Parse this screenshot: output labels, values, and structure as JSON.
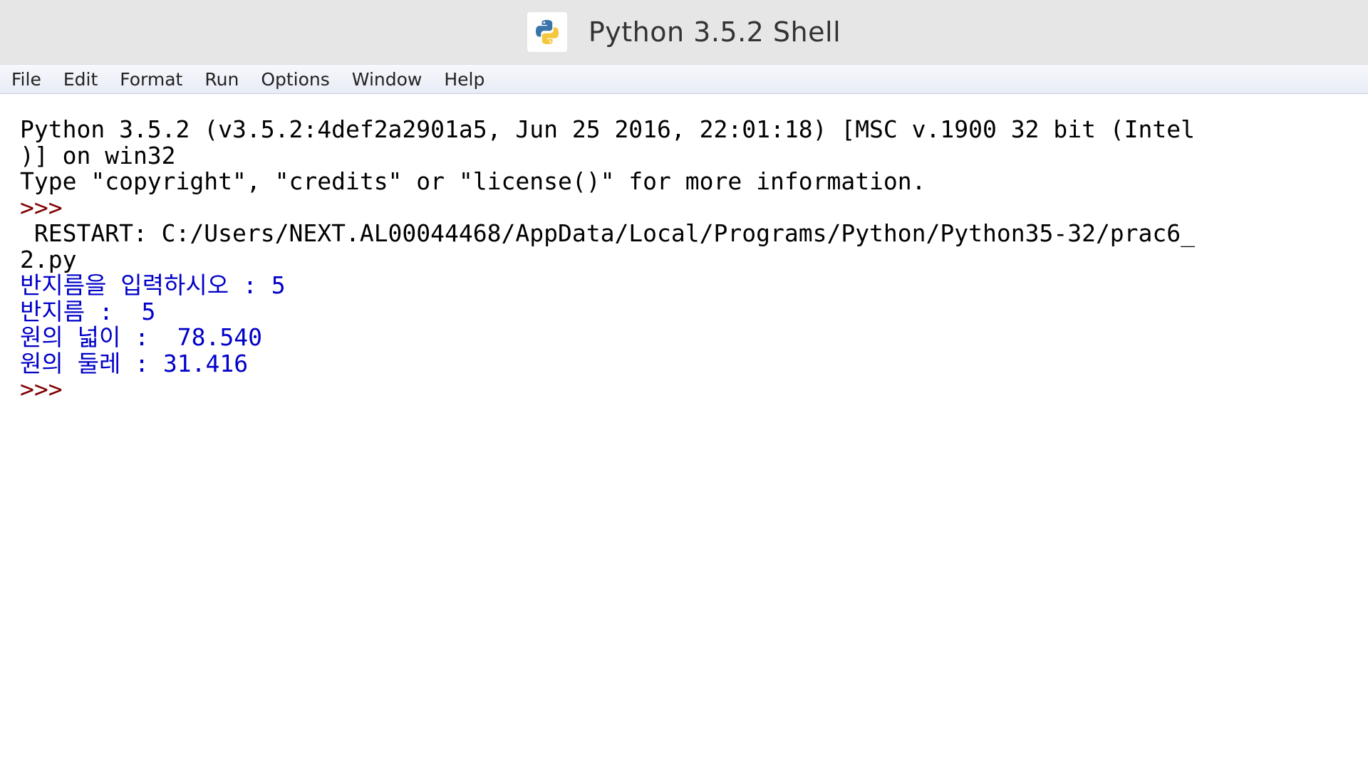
{
  "window": {
    "title": "Python 3.5.2 Shell",
    "icon": "python-icon"
  },
  "menu": {
    "items": [
      {
        "label": "File"
      },
      {
        "label": "Edit"
      },
      {
        "label": "Format"
      },
      {
        "label": "Run"
      },
      {
        "label": "Options"
      },
      {
        "label": "Window"
      },
      {
        "label": "Help"
      }
    ]
  },
  "shell": {
    "banner_line1": "Python 3.5.2 (v3.5.2:4def2a2901a5, Jun 25 2016, 22:01:18) [MSC v.1900 32 bit (Intel",
    "banner_line2": ")] on win32",
    "banner_line3": "Type \"copyright\", \"credits\" or \"license()\" for more information.",
    "prompt1": ">>> ",
    "restart_line1": " RESTART: C:/Users/NEXT.AL00044468/AppData/Local/Programs/Python/Python35-32/prac6_",
    "restart_line2": "2.py",
    "output": [
      "반지름을 입력하시오 : 5",
      "반지름 :  5",
      "원의 넓이 :  78.540",
      "원의 둘레 : 31.416"
    ],
    "prompt2": ">>> "
  },
  "colors": {
    "stdout": "#0000c8",
    "prompt": "#800000",
    "titlebar": "#e6e6e6"
  }
}
